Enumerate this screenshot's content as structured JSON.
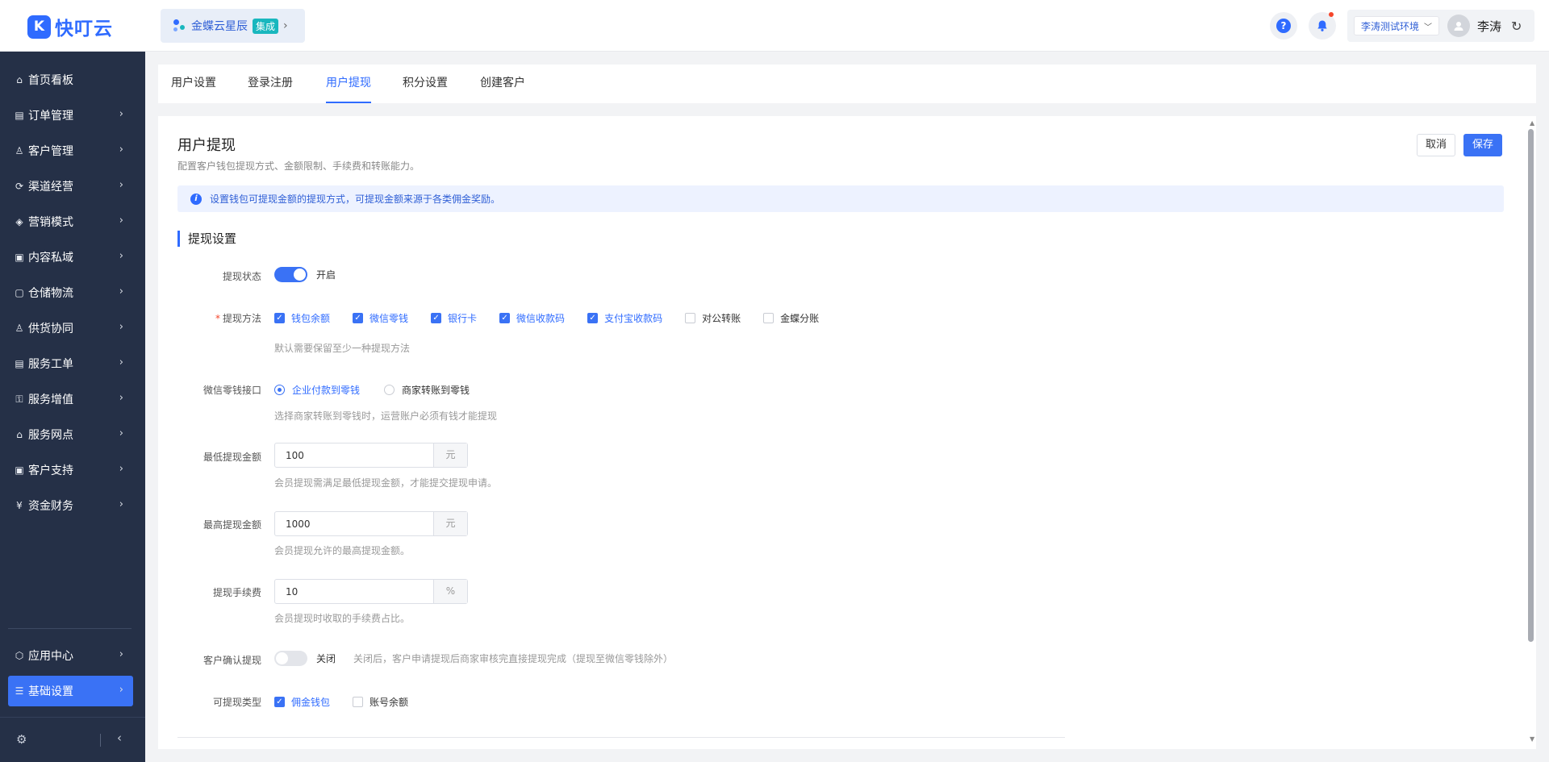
{
  "brand": {
    "name": "快叮云",
    "mark": "K"
  },
  "app_switch": {
    "name": "金蝶云星辰",
    "badge": "集成"
  },
  "header": {
    "help": "?",
    "env": "李涛测试环境",
    "user_name": "李涛"
  },
  "sidebar": {
    "items": [
      {
        "label": "首页看板",
        "icon": "⌂",
        "has_children": false
      },
      {
        "label": "订单管理",
        "icon": "▤",
        "has_children": true
      },
      {
        "label": "客户管理",
        "icon": "♙",
        "has_children": true
      },
      {
        "label": "渠道经营",
        "icon": "⟳",
        "has_children": true
      },
      {
        "label": "营销模式",
        "icon": "◈",
        "has_children": true
      },
      {
        "label": "内容私域",
        "icon": "▣",
        "has_children": true
      },
      {
        "label": "仓储物流",
        "icon": "▢",
        "has_children": true
      },
      {
        "label": "供货协同",
        "icon": "♙",
        "has_children": true
      },
      {
        "label": "服务工单",
        "icon": "▤",
        "has_children": true
      },
      {
        "label": "服务增值",
        "icon": "⚿",
        "has_children": true
      },
      {
        "label": "服务网点",
        "icon": "⌂",
        "has_children": true
      },
      {
        "label": "客户支持",
        "icon": "▣",
        "has_children": true
      },
      {
        "label": "资金财务",
        "icon": "¥",
        "has_children": true
      }
    ],
    "bottom_items": [
      {
        "label": "应用中心",
        "icon": "⬡"
      },
      {
        "label": "基础设置",
        "icon": "☰",
        "active": true
      }
    ]
  },
  "tabs": [
    {
      "label": "用户设置",
      "active": false
    },
    {
      "label": "登录注册",
      "active": false
    },
    {
      "label": "用户提现",
      "active": true
    },
    {
      "label": "积分设置",
      "active": false
    },
    {
      "label": "创建客户",
      "active": false
    }
  ],
  "page": {
    "title": "用户提现",
    "subtitle": "配置客户钱包提现方式、金额限制、手续费和转账能力。",
    "cancel": "取消",
    "save": "保存",
    "notice": "设置钱包可提现金额的提现方式，可提现金额来源于各类佣金奖励。",
    "section": "提现设置"
  },
  "form": {
    "status": {
      "label": "提现状态",
      "value": "开启",
      "on": true
    },
    "methods": {
      "label": "提现方法",
      "required": true,
      "options": [
        {
          "label": "钱包余额",
          "checked": true
        },
        {
          "label": "微信零钱",
          "checked": true
        },
        {
          "label": "银行卡",
          "checked": true
        },
        {
          "label": "微信收款码",
          "checked": true
        },
        {
          "label": "支付宝收款码",
          "checked": true
        },
        {
          "label": "对公转账",
          "checked": false
        },
        {
          "label": "金蝶分账",
          "checked": false
        }
      ],
      "hint": "默认需要保留至少一种提现方法"
    },
    "wechat_api": {
      "label": "微信零钱接口",
      "options": [
        {
          "label": "企业付款到零钱",
          "selected": true
        },
        {
          "label": "商家转账到零钱",
          "selected": false
        }
      ],
      "hint": "选择商家转账到零钱时，运营账户必须有钱才能提现"
    },
    "min_amount": {
      "label": "最低提现金额",
      "value": "100",
      "suffix": "元",
      "hint": "会员提现需满足最低提现金额，才能提交提现申请。"
    },
    "max_amount": {
      "label": "最高提现金额",
      "value": "1000",
      "suffix": "元",
      "hint": "会员提现允许的最高提现金额。"
    },
    "fee": {
      "label": "提现手续费",
      "value": "10",
      "suffix": "%",
      "hint": "会员提现时收取的手续费占比。"
    },
    "confirm": {
      "label": "客户确认提现",
      "value": "关闭",
      "on": false,
      "hint": "关闭后，客户申请提现后商家审核完直接提现完成（提现至微信零钱除外）"
    },
    "types": {
      "label": "可提现类型",
      "options": [
        {
          "label": "佣金钱包",
          "checked": true
        },
        {
          "label": "账号余额",
          "checked": false
        }
      ]
    }
  },
  "colors": {
    "primary": "#3a72f5",
    "sidebar": "#253047"
  }
}
